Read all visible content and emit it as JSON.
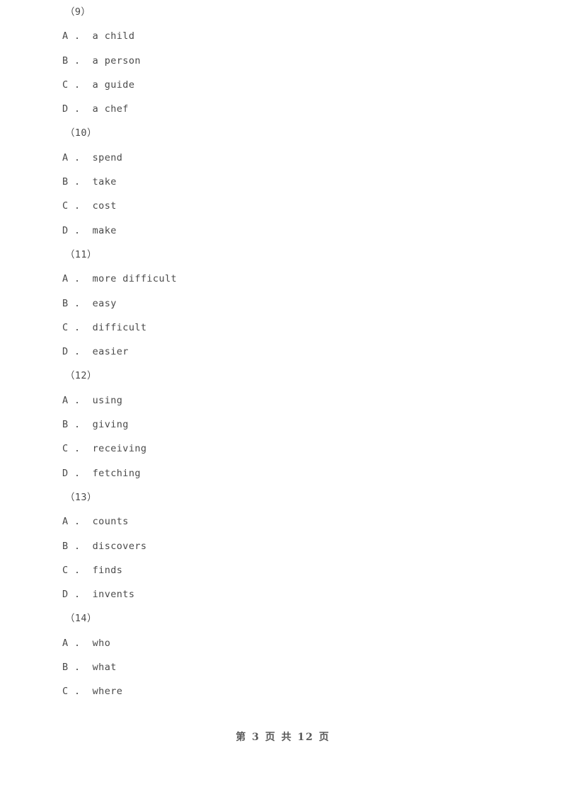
{
  "document": {
    "page_footer": "第 3 页 共 12 页",
    "background_color": "#ffffff",
    "text_color": "#4a4a4a"
  },
  "questions": [
    {
      "number": "（9）",
      "options": [
        {
          "letter": "A .",
          "text": "  a child"
        },
        {
          "letter": "B .",
          "text": "  a person"
        },
        {
          "letter": "C .",
          "text": "  a guide"
        },
        {
          "letter": "D .",
          "text": "  a chef"
        }
      ]
    },
    {
      "number": "（10）",
      "options": [
        {
          "letter": "A .",
          "text": "  spend"
        },
        {
          "letter": "B .",
          "text": "  take"
        },
        {
          "letter": "C .",
          "text": "  cost"
        },
        {
          "letter": "D .",
          "text": "  make"
        }
      ]
    },
    {
      "number": "（11）",
      "options": [
        {
          "letter": "A .",
          "text": "  more difficult"
        },
        {
          "letter": "B .",
          "text": "  easy"
        },
        {
          "letter": "C .",
          "text": "  difficult"
        },
        {
          "letter": "D .",
          "text": "  easier"
        }
      ]
    },
    {
      "number": "（12）",
      "options": [
        {
          "letter": "A .",
          "text": "  using"
        },
        {
          "letter": "B .",
          "text": "  giving"
        },
        {
          "letter": "C .",
          "text": "  receiving"
        },
        {
          "letter": "D .",
          "text": "  fetching"
        }
      ]
    },
    {
      "number": "（13）",
      "options": [
        {
          "letter": "A .",
          "text": "  counts"
        },
        {
          "letter": "B .",
          "text": "  discovers"
        },
        {
          "letter": "C .",
          "text": "  finds"
        },
        {
          "letter": "D .",
          "text": "  invents"
        }
      ]
    },
    {
      "number": "（14）",
      "options": [
        {
          "letter": "A .",
          "text": "  who"
        },
        {
          "letter": "B .",
          "text": "  what"
        },
        {
          "letter": "C .",
          "text": "  where"
        }
      ]
    }
  ]
}
